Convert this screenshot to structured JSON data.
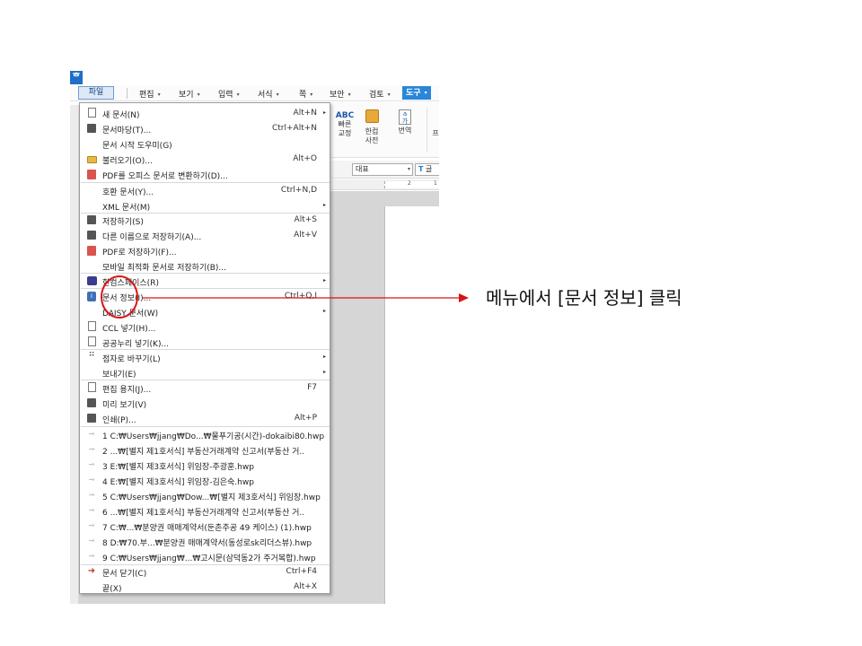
{
  "app": {
    "icon_glyph": "ᄒ"
  },
  "menubar": {
    "items": [
      {
        "label": "파일"
      },
      {
        "label": "편집"
      },
      {
        "label": "보기"
      },
      {
        "label": "입력"
      },
      {
        "label": "서식"
      },
      {
        "label": "쪽"
      },
      {
        "label": "보안"
      },
      {
        "label": "검토"
      },
      {
        "label": "도구"
      }
    ]
  },
  "ribbon": {
    "quick_correct": {
      "icon_text": "ABC",
      "label_line1": "빠른",
      "label_line2": "교정"
    },
    "dictionary": {
      "label_line1": "한컴",
      "label_line2": "사전"
    },
    "translate": {
      "icon_text": "a 가",
      "label": "번역"
    },
    "more_label": "프"
  },
  "format_bar": {
    "style_value": "대표",
    "font_glyph": "T",
    "font_value": "글"
  },
  "ruler": {
    "tick_2": "2",
    "tick_1": "1"
  },
  "file_menu": {
    "items": [
      {
        "label": "새 문서(N)",
        "shortcut": "Alt+N",
        "has_sub": true,
        "icon": "new-document-icon"
      },
      {
        "label": "문서마당(T)...",
        "shortcut": "Ctrl+Alt+N",
        "has_sub": false,
        "icon": "template-icon"
      },
      {
        "label": "문서 시작 도우미(G)",
        "shortcut": "",
        "has_sub": false,
        "icon": ""
      },
      {
        "label": "불러오기(O)...",
        "shortcut": "Alt+O",
        "has_sub": false,
        "icon": "open-folder-icon"
      },
      {
        "label": "PDF를 오피스 문서로 변환하기(D)...",
        "shortcut": "",
        "has_sub": false,
        "icon": "pdf-convert-icon"
      },
      {
        "label": "호환 문서(Y)...",
        "shortcut": "Ctrl+N,D",
        "has_sub": false,
        "icon": ""
      },
      {
        "label": "XML 문서(M)",
        "shortcut": "",
        "has_sub": true,
        "icon": ""
      },
      {
        "label": "저장하기(S)",
        "shortcut": "Alt+S",
        "has_sub": false,
        "icon": "save-icon"
      },
      {
        "label": "다른 이름으로 저장하기(A)...",
        "shortcut": "Alt+V",
        "has_sub": false,
        "icon": "save-as-icon"
      },
      {
        "label": "PDF로 저장하기(F)...",
        "shortcut": "",
        "has_sub": false,
        "icon": "save-pdf-icon"
      },
      {
        "label": "모바일 최적화 문서로 저장하기(B)...",
        "shortcut": "",
        "has_sub": false,
        "icon": ""
      },
      {
        "label": "한컴스페이스(R)",
        "shortcut": "",
        "has_sub": true,
        "icon": "hancom-space-icon"
      },
      {
        "label": "문서 정보(I)...",
        "shortcut": "Ctrl+Q,I",
        "has_sub": false,
        "icon": "document-info-icon"
      },
      {
        "label": "DAISY 문서(W)",
        "shortcut": "",
        "has_sub": true,
        "icon": "daisy-icon"
      },
      {
        "label": "CCL 넣기(H)...",
        "shortcut": "",
        "has_sub": false,
        "icon": "ccl-icon"
      },
      {
        "label": "공공누리 넣기(K)...",
        "shortcut": "",
        "has_sub": false,
        "icon": "kogl-icon"
      },
      {
        "label": "점자로 바꾸기(L)",
        "shortcut": "",
        "has_sub": true,
        "icon": "braille-icon"
      },
      {
        "label": "보내기(E)",
        "shortcut": "",
        "has_sub": true,
        "icon": ""
      },
      {
        "label": "편집 용지(J)...",
        "shortcut": "F7",
        "has_sub": false,
        "icon": "page-setup-icon"
      },
      {
        "label": "미리 보기(V)",
        "shortcut": "",
        "has_sub": false,
        "icon": "preview-icon"
      },
      {
        "label": "인쇄(P)...",
        "shortcut": "Alt+P",
        "has_sub": false,
        "icon": "print-icon"
      }
    ],
    "recent_files": [
      "1 C:₩Users₩jjang₩Do...₩물푸기공(시간)-dokaibi80.hwp",
      "2 ...₩[별지 제1호서식] 부동산거래계약 신고서(부동산 거..",
      "3 E:₩[별지 제3호서식] 위임장-주광훈.hwp",
      "4 E:₩[별지 제3호서식] 위임장-김은숙.hwp",
      "5 C:₩Users₩jjang₩Dow...₩[별지 제3호서식] 위임장.hwp",
      "6 ...₩[별지 제1호서식] 부동산거래계약 신고서(부동산 거..",
      "7 C:₩...₩분양권 매매계약서(둔촌주공 49 케이스) (1).hwp",
      "8 D:₩70.부...₩분양권 매매계약서(동성로sk리더스뷰).hwp",
      "9 C:₩Users₩jjang₩...₩고시문(삼덕동2가 주거복합).hwp"
    ],
    "close_item": {
      "label": "문서 닫기(C)",
      "shortcut": "Ctrl+F4"
    },
    "exit_item": {
      "label": "끝(X)",
      "shortcut": "Alt+X"
    }
  },
  "annotation": {
    "text": "메뉴에서 [문서 정보] 클릭",
    "color": "#d81414"
  }
}
